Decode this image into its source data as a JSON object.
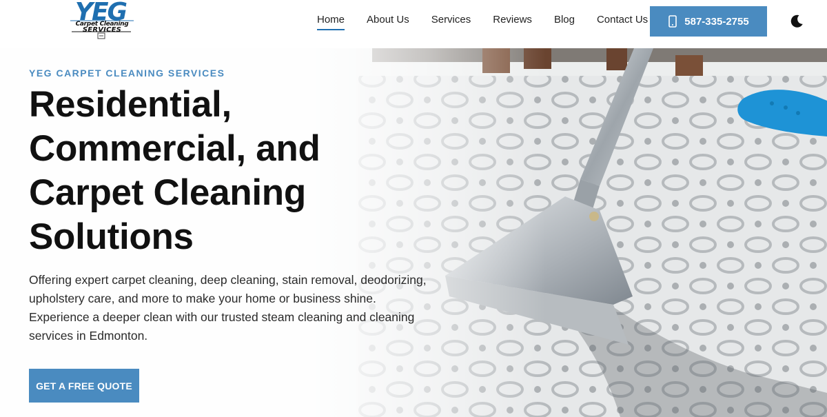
{
  "brand": {
    "logo_main": "YEG",
    "logo_line1": "Carpet Cleaning",
    "logo_line2": "SERVICES"
  },
  "nav": {
    "items": [
      {
        "label": "Home",
        "active": true
      },
      {
        "label": "About Us"
      },
      {
        "label": "Services"
      },
      {
        "label": "Reviews"
      },
      {
        "label": "Blog"
      },
      {
        "label": "Contact Us"
      }
    ],
    "phone_label": "587-335-2755",
    "phone_icon": "mobile-phone-icon",
    "theme_icon": "moon-icon"
  },
  "hero": {
    "eyebrow": "YEG CARPET CLEANING SERVICES",
    "headline_lines": [
      "Residential,",
      "Commercial, and",
      "Carpet Cleaning",
      "Solutions"
    ],
    "description": "Offering expert carpet cleaning, deep cleaning, stain removal, deodorizing, upholstery care, and more to make your home or business shine. Experience a deeper clean with our trusted steam cleaning and cleaning services in Edmonton.",
    "cta_label": "GET A FREE QUOTE"
  },
  "colors": {
    "accent": "#4a8bc0",
    "nav_active": "#1f6fb0",
    "text": "#111111"
  }
}
